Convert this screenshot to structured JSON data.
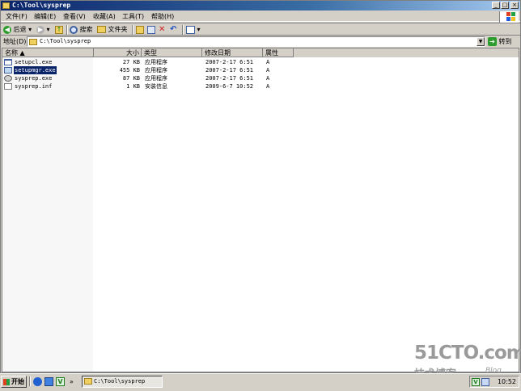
{
  "window": {
    "title": "C:\\Tool\\sysprep"
  },
  "menu": {
    "items": [
      "文件(F)",
      "编辑(E)",
      "查看(V)",
      "收藏(A)",
      "工具(T)",
      "帮助(H)"
    ]
  },
  "toolbar": {
    "back_label": "后退",
    "search_label": "搜索",
    "folders_label": "文件夹"
  },
  "address": {
    "label": "地址(D)",
    "value": "C:\\Tool\\sysprep",
    "go_label": "转到"
  },
  "list": {
    "columns": {
      "name": "名称 ▲",
      "size": "大小",
      "type": "类型",
      "modified": "修改日期",
      "attributes": "属性"
    },
    "rows": [
      {
        "name": "setupcl.exe",
        "size": "27 KB",
        "type": "应用程序",
        "modified": "2007-2-17 6:51",
        "attr": "A",
        "icon": "exe-window-icon"
      },
      {
        "name": "setupmgr.exe",
        "size": "455 KB",
        "type": "应用程序",
        "modified": "2007-2-17 6:51",
        "attr": "A",
        "icon": "exe-setup-icon"
      },
      {
        "name": "sysprep.exe",
        "size": "87 KB",
        "type": "应用程序",
        "modified": "2007-2-17 6:51",
        "attr": "A",
        "icon": "gear-icon"
      },
      {
        "name": "sysprep.inf",
        "size": "1 KB",
        "type": "安装信息",
        "modified": "2009-6-7 10:52",
        "attr": "A",
        "icon": "document-icon"
      }
    ],
    "selected_row": 1
  },
  "watermark": {
    "brand": "51CTO.com",
    "tagline": "技术博客",
    "blog": "Blog"
  },
  "taskbar": {
    "start_label": "开始",
    "task_label": "C:\\Tool\\sysprep",
    "clock": "10:52"
  },
  "colors": {
    "title_start": "#0a246a",
    "selection": "#0a246a",
    "chrome": "#d4d0c8"
  }
}
